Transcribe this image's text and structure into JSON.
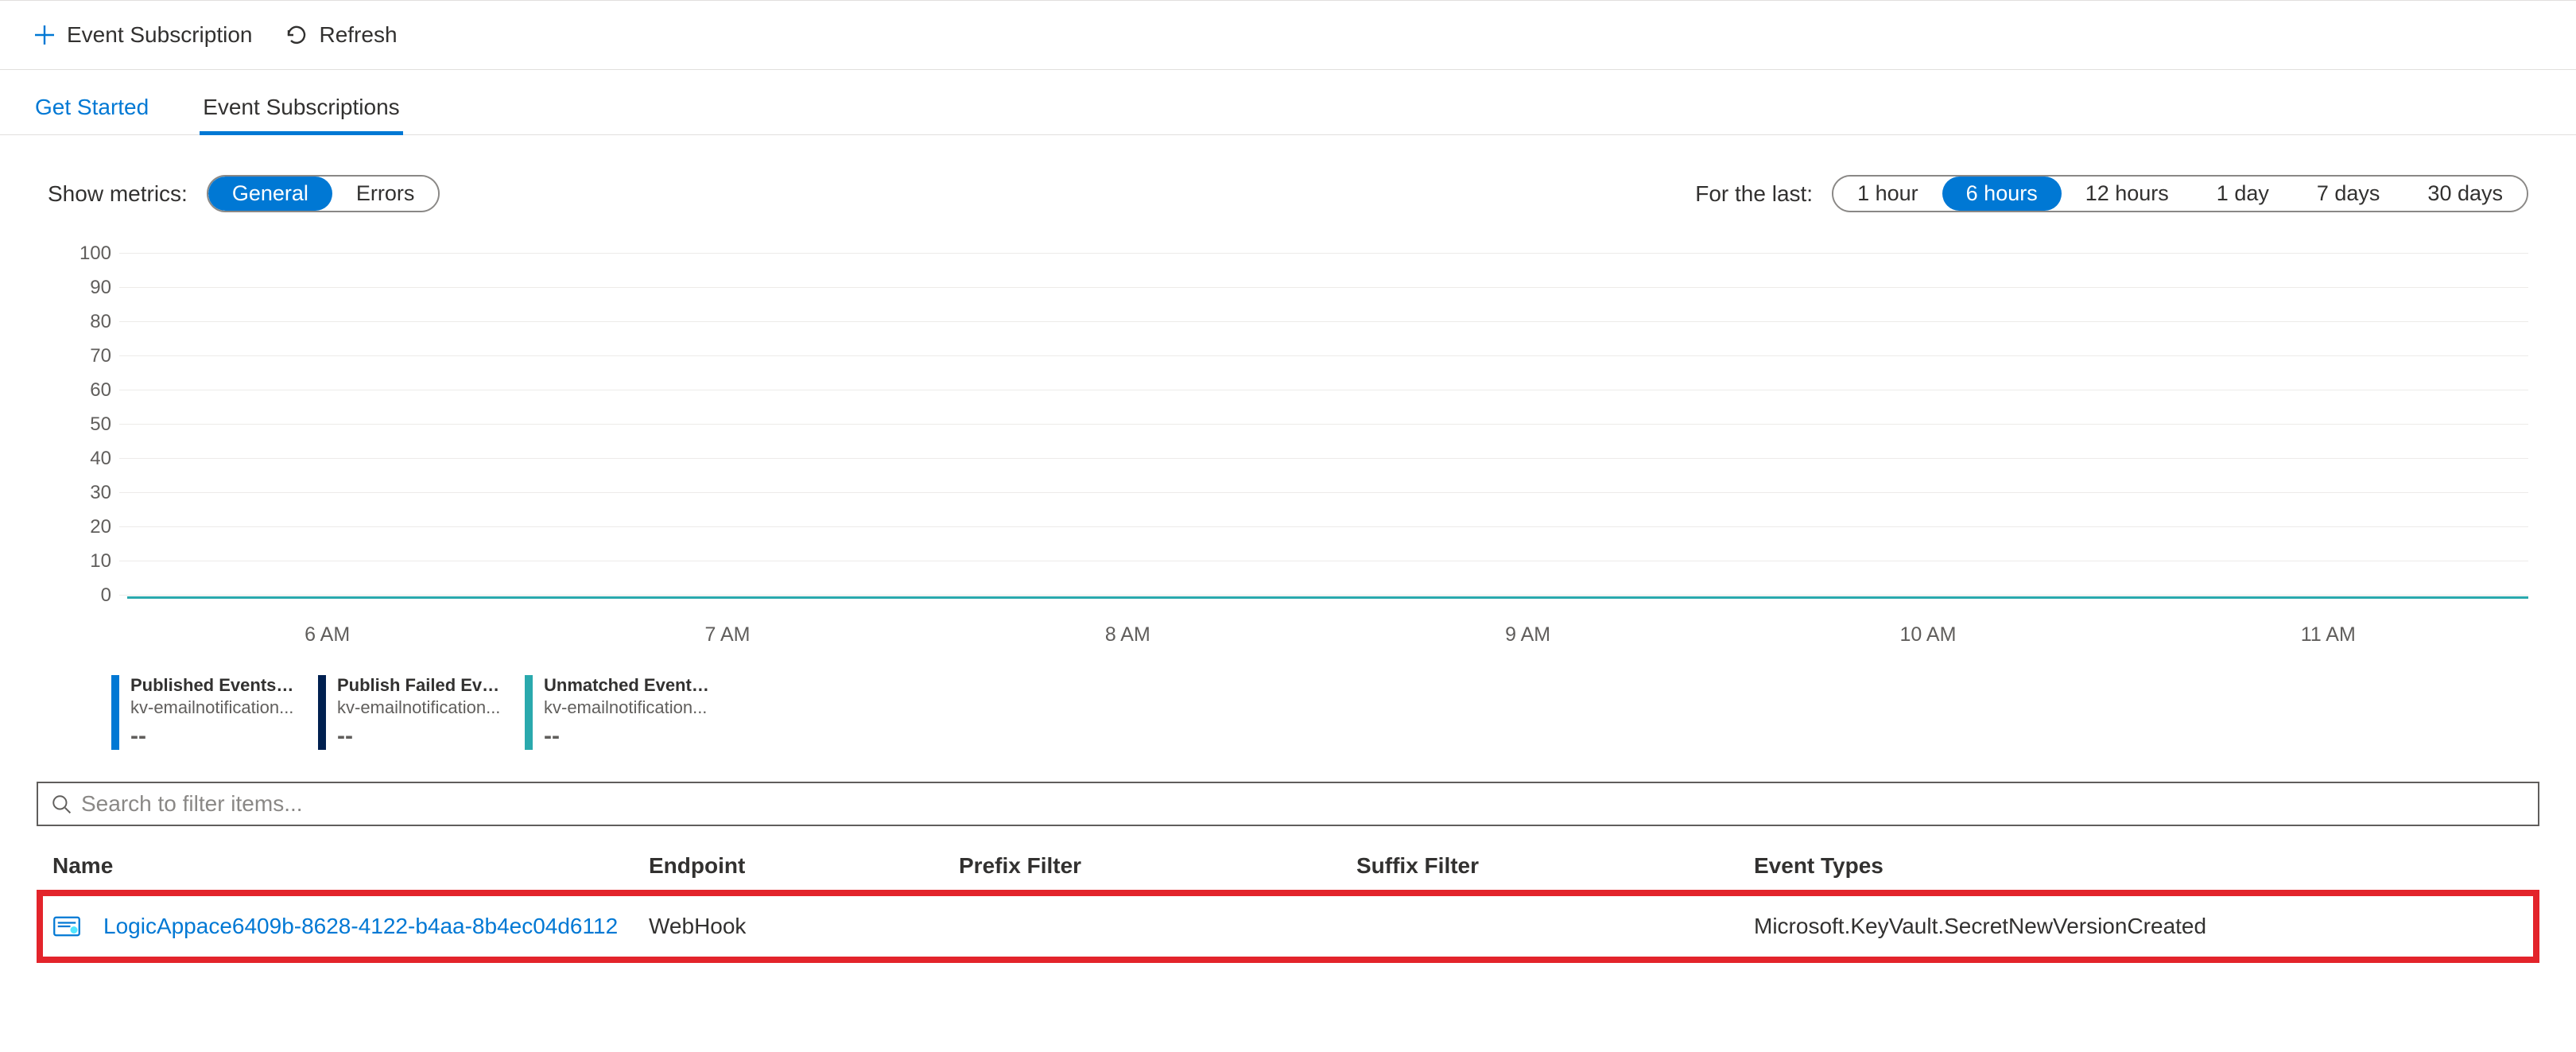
{
  "toolbar": {
    "event_subscription_label": "Event Subscription",
    "refresh_label": "Refresh"
  },
  "tabs": {
    "get_started": "Get Started",
    "event_subscriptions": "Event Subscriptions"
  },
  "filters": {
    "show_metrics_label": "Show metrics:",
    "metrics_options": [
      "General",
      "Errors"
    ],
    "metrics_selected": "General",
    "for_last_label": "For the last:",
    "time_options": [
      "1 hour",
      "6 hours",
      "12 hours",
      "1 day",
      "7 days",
      "30 days"
    ],
    "time_selected": "6 hours"
  },
  "chart_data": {
    "type": "line",
    "title": "",
    "xlabel": "",
    "ylabel": "",
    "ylim": [
      0,
      100
    ],
    "y_ticks": [
      100,
      90,
      80,
      70,
      60,
      50,
      40,
      30,
      20,
      10,
      0
    ],
    "x_ticks": [
      "6 AM",
      "7 AM",
      "8 AM",
      "9 AM",
      "10 AM",
      "11 AM"
    ],
    "x": [
      "6 AM",
      "7 AM",
      "8 AM",
      "9 AM",
      "10 AM",
      "11 AM"
    ],
    "series": [
      {
        "name": "Published Events (Sum)",
        "sublabel": "kv-emailnotification...",
        "color": "#0078d4",
        "value": "--",
        "values": [
          0,
          0,
          0,
          0,
          0,
          0
        ]
      },
      {
        "name": "Publish Failed Event...",
        "sublabel": "kv-emailnotification...",
        "color": "#002050",
        "value": "--",
        "values": [
          0,
          0,
          0,
          0,
          0,
          0
        ]
      },
      {
        "name": "Unmatched Events (Sum)",
        "sublabel": "kv-emailnotification...",
        "color": "#2aa9ad",
        "value": "--",
        "values": [
          0,
          0,
          0,
          0,
          0,
          0
        ]
      }
    ]
  },
  "search": {
    "placeholder": "Search to filter items..."
  },
  "table": {
    "headers": {
      "name": "Name",
      "endpoint": "Endpoint",
      "prefix": "Prefix Filter",
      "suffix": "Suffix Filter",
      "types": "Event Types"
    },
    "rows": [
      {
        "name": "LogicAppace6409b-8628-4122-b4aa-8b4ec04d6112",
        "endpoint": "WebHook",
        "prefix": "",
        "suffix": "",
        "types": "Microsoft.KeyVault.SecretNewVersionCreated"
      }
    ]
  }
}
